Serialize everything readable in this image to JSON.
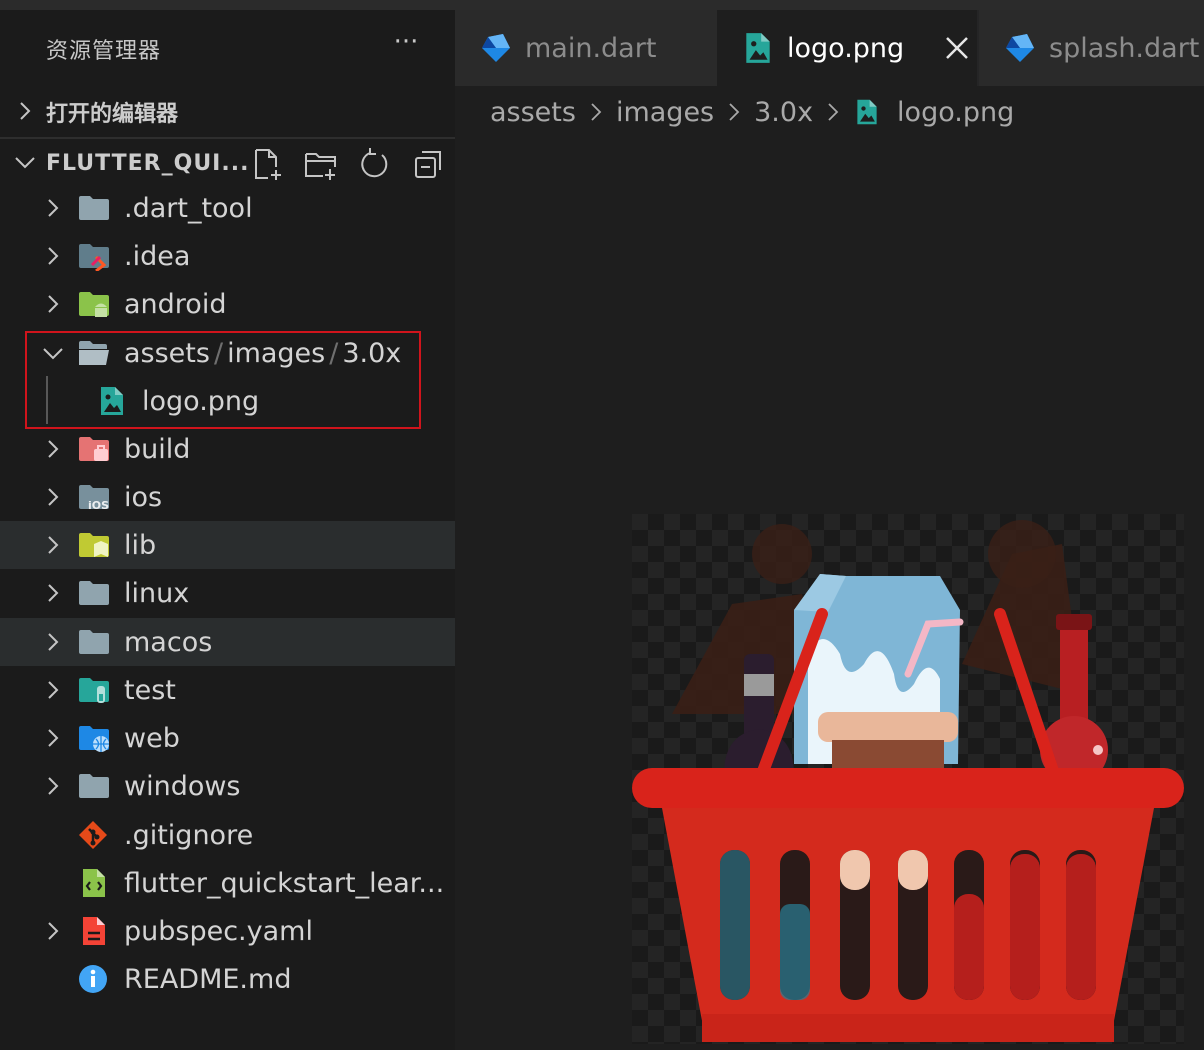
{
  "explorer": {
    "title": "资源管理器",
    "more_label": "···",
    "open_editors_label": "打开的编辑器",
    "project_label": "FLUTTER_QUI...",
    "tree": [
      {
        "name": ".dart_tool",
        "icon": "folder-icon",
        "color": "#90a4ae"
      },
      {
        "name": ".idea",
        "icon": "folder-idea-icon",
        "color": "#90a4ae"
      },
      {
        "name": "android",
        "icon": "folder-android-icon",
        "color": "#8bc34a"
      },
      {
        "path_parts": [
          "assets",
          "images",
          "3.0x"
        ],
        "separator": "/",
        "icon": "folder-open-icon",
        "expanded": true
      },
      {
        "name": "logo.png",
        "icon": "image-file-icon",
        "color": "#26a69a"
      },
      {
        "name": "build",
        "icon": "folder-build-icon",
        "color": "#e57373"
      },
      {
        "name": "ios",
        "icon": "folder-ios-icon",
        "color": "#90a4ae"
      },
      {
        "name": "lib",
        "icon": "folder-lib-icon",
        "color": "#c0ca33"
      },
      {
        "name": "linux",
        "icon": "folder-icon",
        "color": "#90a4ae"
      },
      {
        "name": "macos",
        "icon": "folder-icon",
        "color": "#90a4ae"
      },
      {
        "name": "test",
        "icon": "folder-test-icon",
        "color": "#26a69a"
      },
      {
        "name": "web",
        "icon": "folder-web-icon",
        "color": "#42a5f5"
      },
      {
        "name": "windows",
        "icon": "folder-icon",
        "color": "#90a4ae"
      },
      {
        "name": ".gitignore",
        "icon": "git-icon",
        "color": "#e64a19"
      },
      {
        "name": "flutter_quickstart_lear...",
        "icon": "iml-file-icon",
        "color": "#8bc34a"
      },
      {
        "name": "pubspec.yaml",
        "icon": "yaml-file-icon",
        "color": "#f44336"
      },
      {
        "name": "README.md",
        "icon": "info-icon",
        "color": "#42a5f5"
      }
    ]
  },
  "tabs": [
    {
      "label": "main.dart",
      "icon": "dart-icon",
      "active": false
    },
    {
      "label": "logo.png",
      "icon": "image-file-icon",
      "active": true
    },
    {
      "label": "splash.dart",
      "icon": "dart-icon",
      "active": false
    }
  ],
  "breadcrumb": [
    "assets",
    "images",
    "3.0x",
    "logo.png"
  ],
  "colors": {
    "editor_bg": "#1e1e1e",
    "sidebar_bg": "#1b1b1b",
    "highlight_box": "#d0141c",
    "dart_blue": "#42a5f5",
    "image_icon": "#26a69a"
  }
}
